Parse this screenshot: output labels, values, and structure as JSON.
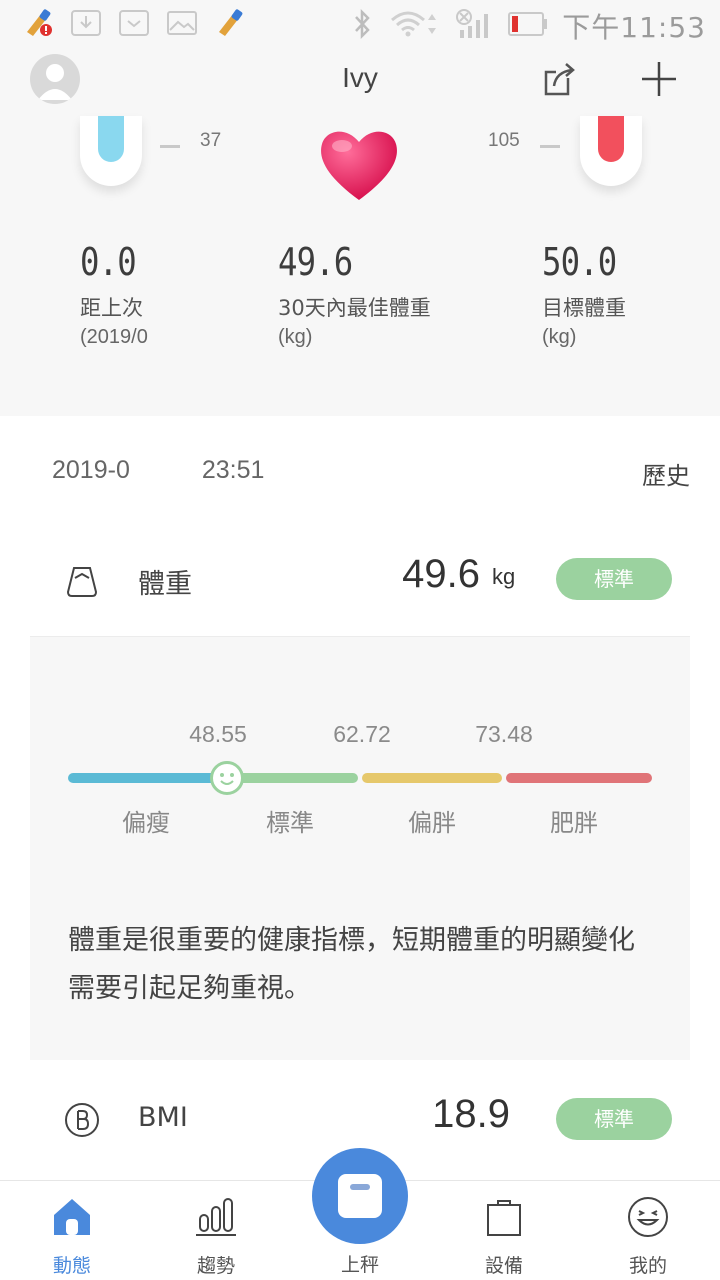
{
  "status_bar": {
    "time": "下午11:53"
  },
  "header": {
    "user_name": "Ivy",
    "share_icon": "share-icon",
    "add_icon": "plus-icon",
    "avatar_icon": "avatar-icon"
  },
  "summary": {
    "scale_left": "37",
    "scale_right": "105",
    "stats": [
      {
        "value": "0.0",
        "label": "距上次",
        "sub": "(2019/0"
      },
      {
        "value": "49.6",
        "label": "30天內最佳體重",
        "sub": "(kg)"
      },
      {
        "value": "50.0",
        "label": "目標體重",
        "sub": "(kg)"
      }
    ]
  },
  "record": {
    "date_prefix": "2019-0",
    "date_suffix": "23:51",
    "history_label": "歷史"
  },
  "weight": {
    "name": "體重",
    "value": "49.6",
    "unit": "kg",
    "status": "標準",
    "ranges": [
      "48.55",
      "62.72",
      "73.48"
    ],
    "labels": [
      "偏瘦",
      "標準",
      "偏胖",
      "肥胖"
    ],
    "description": "體重是很重要的健康指標，短期體重的明顯變化需要引起足夠重視。"
  },
  "bmi": {
    "name": "BMI",
    "value": "18.9",
    "status": "標準"
  },
  "nav": {
    "items": [
      {
        "label": "動態",
        "icon": "home-icon"
      },
      {
        "label": "趨勢",
        "icon": "trend-icon"
      },
      {
        "label": "上秤",
        "icon": "scale-icon"
      },
      {
        "label": "設備",
        "icon": "device-icon"
      },
      {
        "label": "我的",
        "icon": "profile-icon"
      }
    ]
  },
  "colors": {
    "accent": "#4a89dc",
    "status_green": "#9bd29f",
    "bar_thin": "#5bbad5",
    "bar_normal": "#9bd29f",
    "bar_over": "#e6c86b",
    "bar_obese": "#e07478"
  }
}
